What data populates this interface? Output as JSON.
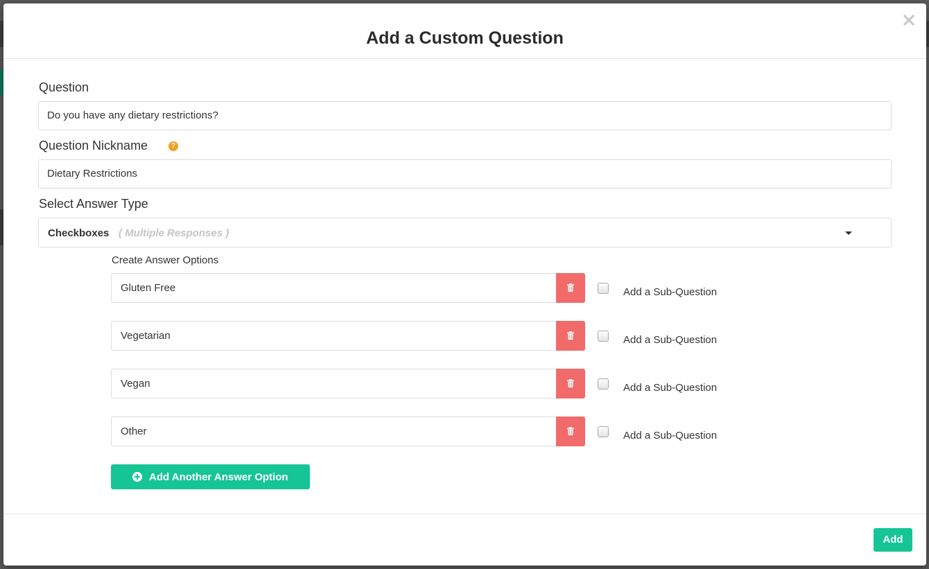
{
  "modal": {
    "title": "Add a Custom Question",
    "close_icon": "close-icon"
  },
  "question": {
    "label": "Question",
    "value": "Do you have any dietary restrictions?"
  },
  "nickname": {
    "label": "Question Nickname",
    "help_icon": "question-circle-icon",
    "help_glyph": "?",
    "value": "Dietary Restrictions"
  },
  "answer_type": {
    "label": "Select Answer Type",
    "selected": "Checkboxes",
    "hint": "( Multiple Responses )"
  },
  "answer_options": {
    "label": "Create Answer Options",
    "items": [
      {
        "value": "Gluten Free",
        "sub_question_label": "Add a Sub-Question",
        "sub_question_checked": false
      },
      {
        "value": "Vegetarian",
        "sub_question_label": "Add a Sub-Question",
        "sub_question_checked": false
      },
      {
        "value": "Vegan",
        "sub_question_label": "Add a Sub-Question",
        "sub_question_checked": false
      },
      {
        "value": "Other",
        "sub_question_label": "Add a Sub-Question",
        "sub_question_checked": false
      }
    ],
    "add_button_label": "Add Another Answer Option",
    "add_button_icon": "plus-circle-icon",
    "delete_icon": "trash-icon"
  },
  "footer": {
    "add_label": "Add"
  },
  "colors": {
    "accent": "#16c596",
    "danger": "#f26b6b",
    "help": "#f0a020"
  }
}
